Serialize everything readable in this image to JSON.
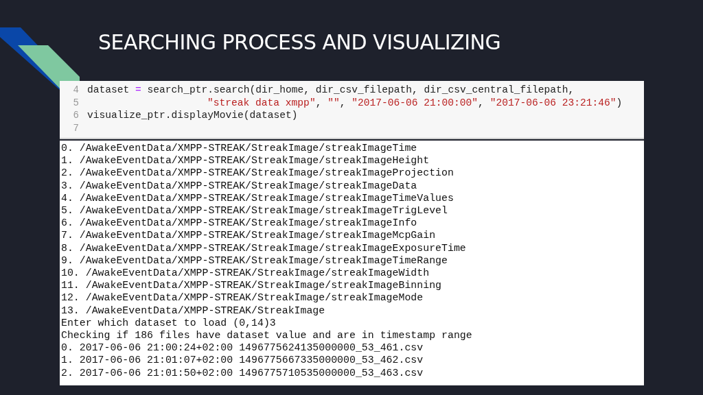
{
  "slide": {
    "title": "SEARCHING PROCESS AND VISUALIZING"
  },
  "code_cell": {
    "lines": [
      {
        "number": "4",
        "segments": [
          {
            "kind": "plain",
            "text": "dataset "
          },
          {
            "kind": "operator",
            "text": "="
          },
          {
            "kind": "plain",
            "text": " search_ptr.search(dir_home, dir_csv_filepath, dir_csv_central_filepath,"
          }
        ]
      },
      {
        "number": "5",
        "continued": true,
        "segments": [
          {
            "kind": "string",
            "text": "\"streak data xmpp\""
          },
          {
            "kind": "plain",
            "text": ", "
          },
          {
            "kind": "string",
            "text": "\"\""
          },
          {
            "kind": "plain",
            "text": ", "
          },
          {
            "kind": "string",
            "text": "\"2017-06-06 21:00:00\""
          },
          {
            "kind": "plain",
            "text": ", "
          },
          {
            "kind": "string",
            "text": "\"2017-06-06 23:21:46\""
          },
          {
            "kind": "plain",
            "text": ")"
          }
        ]
      },
      {
        "number": "6",
        "segments": [
          {
            "kind": "plain",
            "text": "visualize_ptr.displayMovie(dataset)"
          }
        ]
      },
      {
        "number": "7"
      }
    ]
  },
  "output": {
    "lines": [
      "0. /AwakeEventData/XMPP-STREAK/StreakImage/streakImageTime",
      "1. /AwakeEventData/XMPP-STREAK/StreakImage/streakImageHeight",
      "2. /AwakeEventData/XMPP-STREAK/StreakImage/streakImageProjection",
      "3. /AwakeEventData/XMPP-STREAK/StreakImage/streakImageData",
      "4. /AwakeEventData/XMPP-STREAK/StreakImage/streakImageTimeValues",
      "5. /AwakeEventData/XMPP-STREAK/StreakImage/streakImageTrigLevel",
      "6. /AwakeEventData/XMPP-STREAK/StreakImage/streakImageInfo",
      "7. /AwakeEventData/XMPP-STREAK/StreakImage/streakImageMcpGain",
      "8. /AwakeEventData/XMPP-STREAK/StreakImage/streakImageExposureTime",
      "9. /AwakeEventData/XMPP-STREAK/StreakImage/streakImageTimeRange",
      "10. /AwakeEventData/XMPP-STREAK/StreakImage/streakImageWidth",
      "11. /AwakeEventData/XMPP-STREAK/StreakImage/streakImageBinning",
      "12. /AwakeEventData/XMPP-STREAK/StreakImage/streakImageMode",
      "13. /AwakeEventData/XMPP-STREAK/StreakImage",
      "Enter which dataset to load (0,14)3",
      "Checking if 186 files have dataset value and are in timestamp range",
      "0. 2017-06-06 21:00:24+02:00 1496775624135000000_53_461.csv",
      "1. 2017-06-06 21:01:07+02:00 1496775667335000000_53_462.csv",
      "2. 2017-06-06 21:01:50+02:00 1496775710535000000_53_463.csv"
    ]
  }
}
